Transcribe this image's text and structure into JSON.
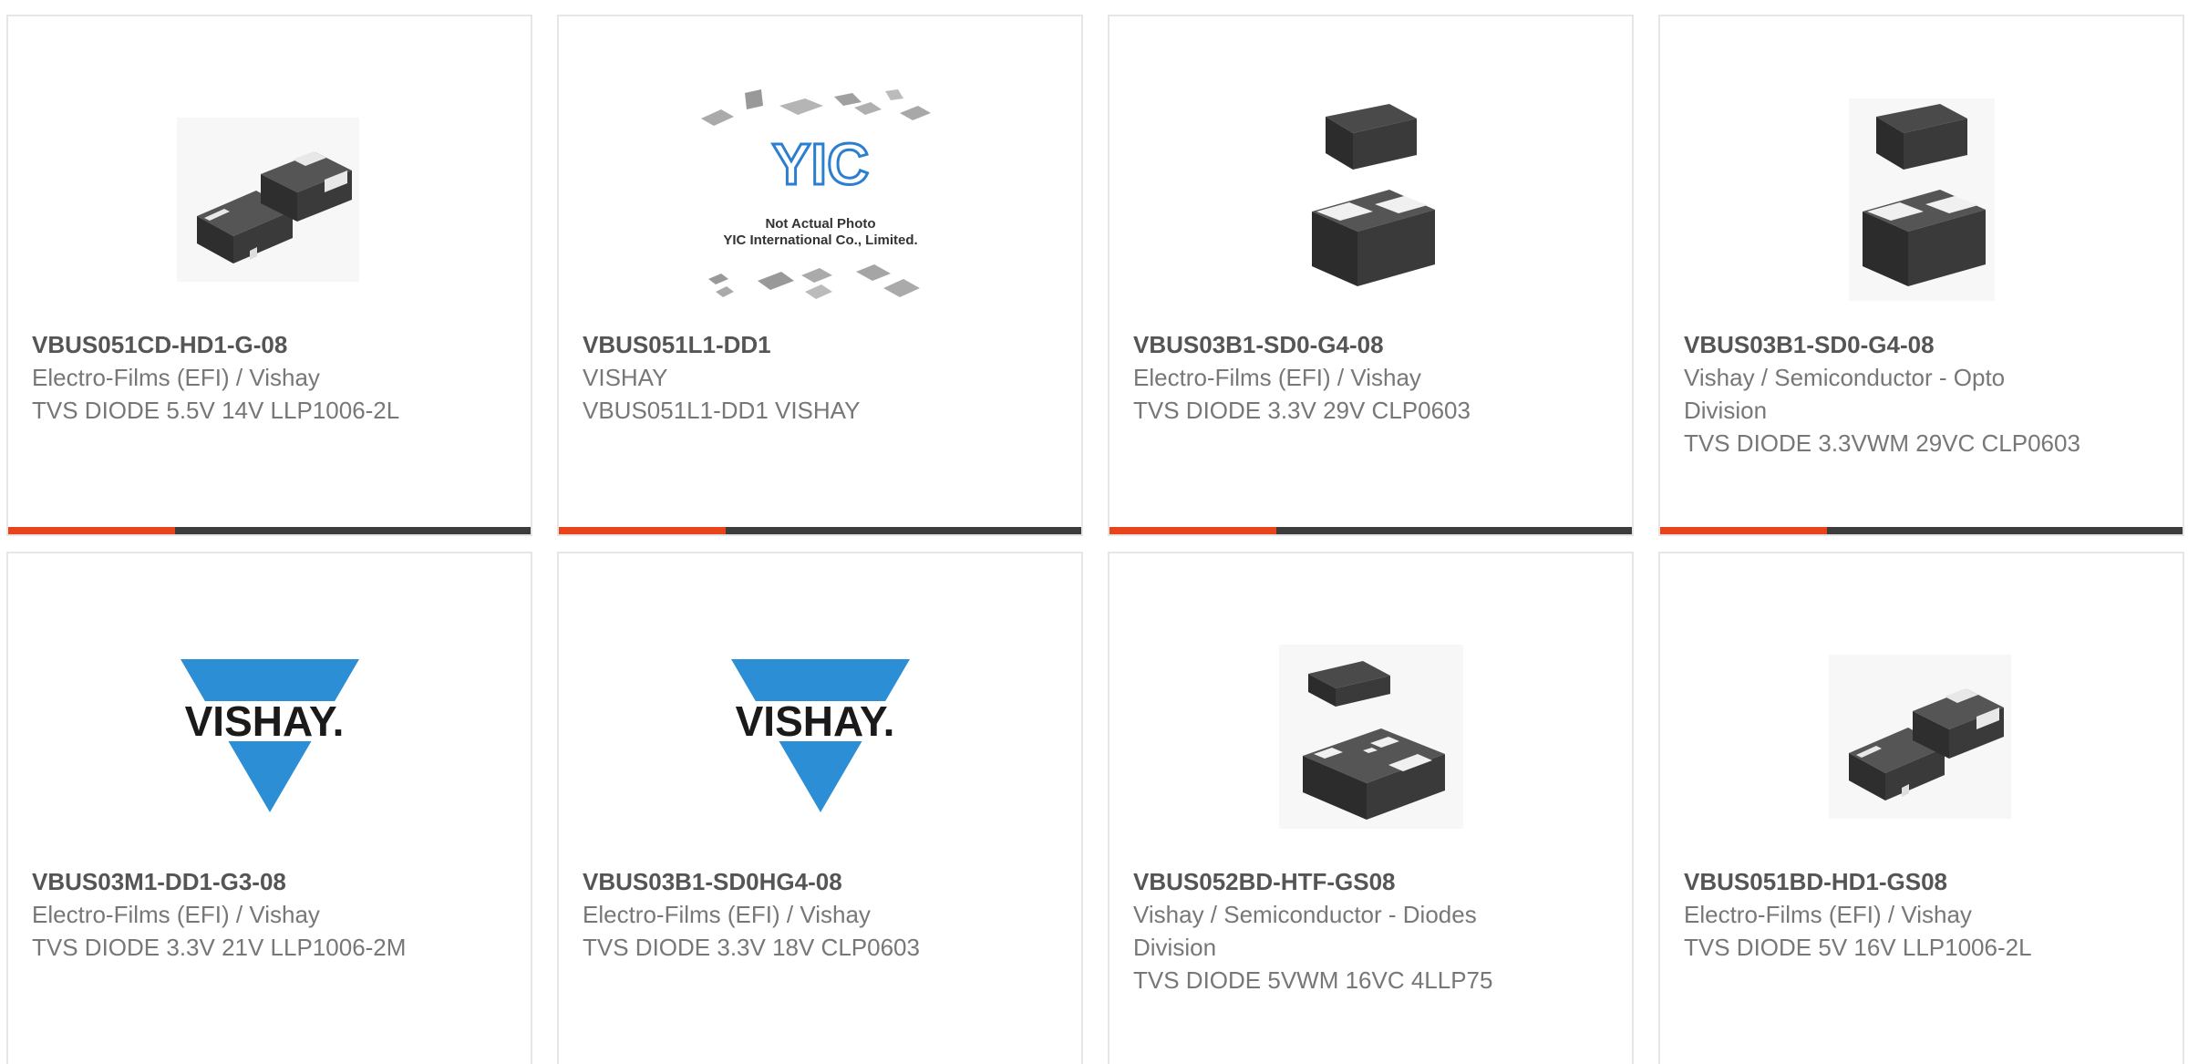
{
  "colors": {
    "accent": "#e8431b",
    "bar": "#3c3c3c",
    "vishay_blue": "#2c8fd6",
    "yic_blue": "#2a7fd0"
  },
  "products": [
    {
      "part": "VBUS051CD-HD1-G-08",
      "manufacturer": "Electro-Films (EFI) / Vishay",
      "description": "TVS DIODE 5.5V 14V LLP1006-2L",
      "image": "dual-chip-package-photo"
    },
    {
      "part": "VBUS051L1-DD1",
      "manufacturer": "VISHAY",
      "description": "VBUS051L1-DD1 VISHAY",
      "image": "yic-not-actual-photo",
      "image_text": {
        "logo": "YIC",
        "line1": "Not Actual Photo",
        "line2": "YIC International Co., Limited."
      }
    },
    {
      "part": "VBUS03B1-SD0-G4-08",
      "manufacturer": "Electro-Films (EFI) / Vishay",
      "description": "TVS DIODE 3.3V 29V CLP0603",
      "image": "stacked-chip-package-photo"
    },
    {
      "part": "VBUS03B1-SD0-G4-08",
      "manufacturer": "Vishay / Semiconductor - Opto Division",
      "description": "TVS DIODE 3.3VWM 29VC CLP0603",
      "image": "stacked-chip-package-photo"
    },
    {
      "part": "VBUS03M1-DD1-G3-08",
      "manufacturer": "Electro-Films (EFI) / Vishay",
      "description": "TVS DIODE 3.3V 21V LLP1006-2M",
      "image": "vishay-logo",
      "image_text": {
        "logo": "VISHAY."
      }
    },
    {
      "part": "VBUS03B1-SD0HG4-08",
      "manufacturer": "Electro-Films (EFI) / Vishay",
      "description": "TVS DIODE 3.3V 18V CLP0603",
      "image": "vishay-logo",
      "image_text": {
        "logo": "VISHAY."
      }
    },
    {
      "part": "VBUS052BD-HTF-GS08",
      "manufacturer": "Vishay / Semiconductor - Diodes Division",
      "description": "TVS DIODE 5VWM 16VC 4LLP75",
      "image": "qfn-package-photo"
    },
    {
      "part": "VBUS051BD-HD1-GS08",
      "manufacturer": "Electro-Films (EFI) / Vishay",
      "description": "TVS DIODE 5V 16V LLP1006-2L",
      "image": "dual-chip-package-photo"
    }
  ]
}
